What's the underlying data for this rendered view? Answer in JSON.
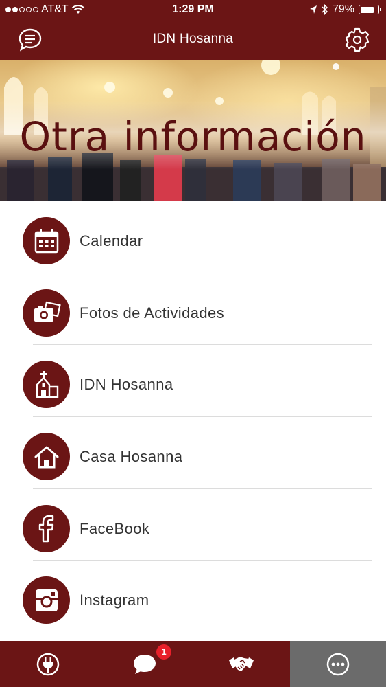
{
  "status_bar": {
    "carrier": "AT&T",
    "time": "1:29 PM",
    "battery": "79%",
    "battery_level": 0.79,
    "signal_bars_filled": 2,
    "signal_bars_total": 5
  },
  "nav": {
    "title": "IDN Hosanna",
    "left_icon": "chat-bubble-icon",
    "right_icon": "gear-icon"
  },
  "hero": {
    "title": "Otra información"
  },
  "menu": {
    "items": [
      {
        "label": "Calendar",
        "icon": "calendar-icon"
      },
      {
        "label": "Fotos de Actividades",
        "icon": "camera-photos-icon"
      },
      {
        "label": "IDN Hosanna",
        "icon": "church-icon"
      },
      {
        "label": "Casa Hosanna",
        "icon": "house-icon"
      },
      {
        "label": "FaceBook",
        "icon": "facebook-icon"
      },
      {
        "label": "Instagram",
        "icon": "instagram-icon"
      }
    ]
  },
  "tabbar": {
    "tabs": [
      {
        "icon": "plug-icon"
      },
      {
        "icon": "chat-icon",
        "badge": "1"
      },
      {
        "icon": "handshake-icon"
      },
      {
        "icon": "more-icon",
        "active": true
      }
    ]
  },
  "colors": {
    "brand": "#6b1515",
    "active_tab": "#6b6b6b",
    "badge": "#e8202a"
  }
}
